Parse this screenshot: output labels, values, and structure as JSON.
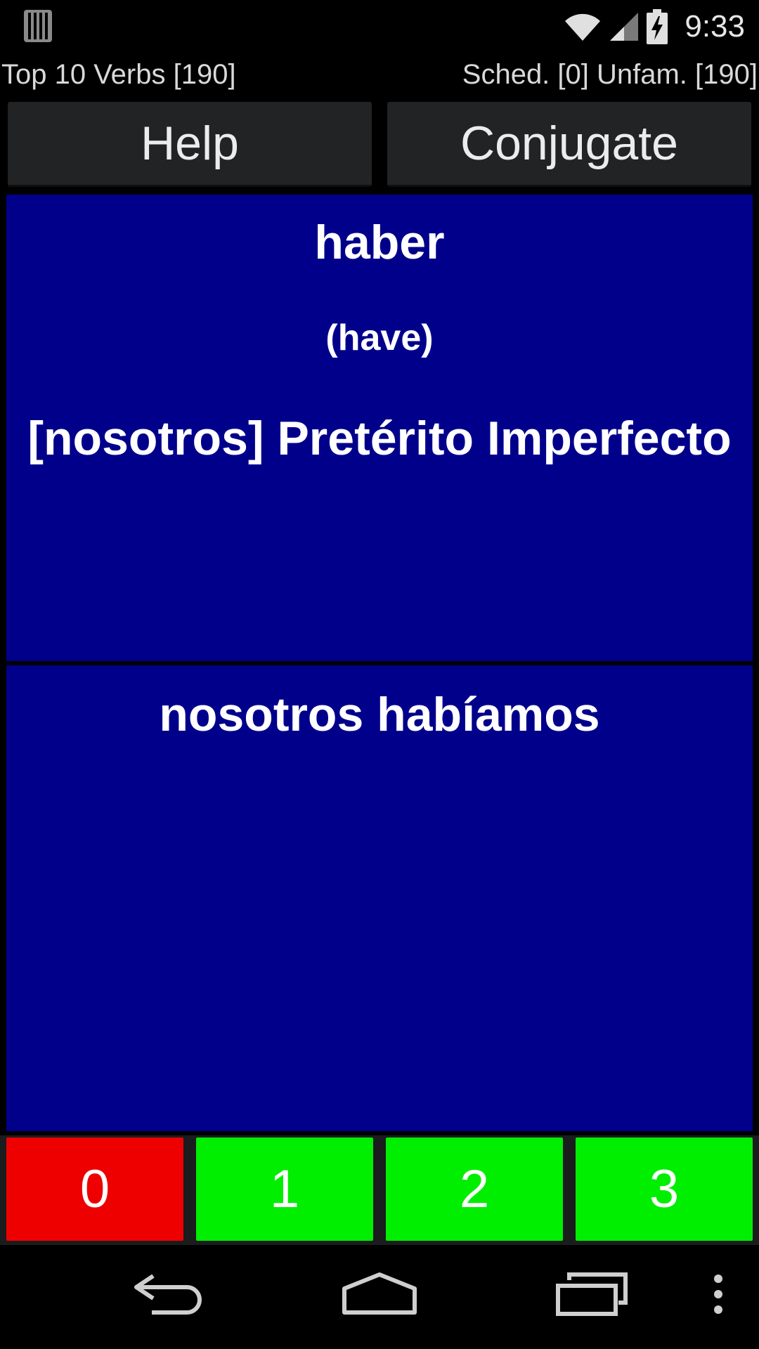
{
  "status_bar": {
    "time": "9:33",
    "icons": [
      "notification-bars-icon",
      "wifi-icon",
      "signal-icon",
      "battery-charging-icon"
    ]
  },
  "header": {
    "deck_title": "Top 10 Verbs [190]",
    "stats": "Sched. [0] Unfam. [190]"
  },
  "buttons": {
    "help": "Help",
    "conjugate": "Conjugate"
  },
  "question": {
    "verb": "haber",
    "translation": "(have)",
    "prompt": "[nosotros] Pretérito Imperfecto"
  },
  "answer": {
    "text": "nosotros habíamos"
  },
  "ratings": [
    {
      "label": "0",
      "color": "#ee0000"
    },
    {
      "label": "1",
      "color": "#00ee00"
    },
    {
      "label": "2",
      "color": "#00ee00"
    },
    {
      "label": "3",
      "color": "#00ee00"
    }
  ],
  "colors": {
    "card_background": "#00008b",
    "button_background": "#212325"
  },
  "nav_bar": {
    "icons": [
      "back-icon",
      "home-icon",
      "recent-apps-icon",
      "overflow-menu-icon"
    ]
  }
}
